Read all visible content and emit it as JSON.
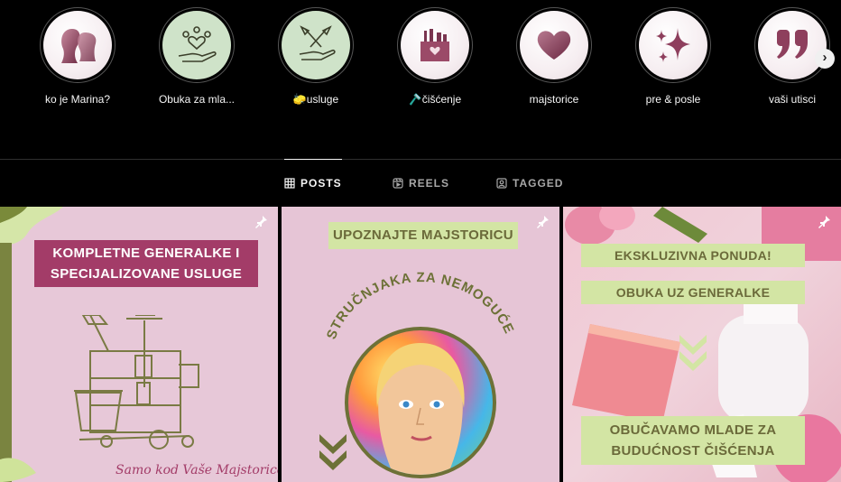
{
  "highlights": [
    {
      "label": "ko je Marina?",
      "icon": "women-faces-icon"
    },
    {
      "label": "Obuka za mla...",
      "icon": "hand-heart-people-icon"
    },
    {
      "label": "🧽usluge",
      "icon": "hand-brooms-icon"
    },
    {
      "label": "🪒čišćenje",
      "icon": "cleaning-bucket-heart-icon"
    },
    {
      "label": "majstorice",
      "icon": "heart-icon"
    },
    {
      "label": "pre & posle",
      "icon": "sparkles-icon"
    },
    {
      "label": "vaši utisci",
      "icon": "quote-icon"
    }
  ],
  "tabs": [
    {
      "label": "POSTS",
      "active": true
    },
    {
      "label": "REELS",
      "active": false
    },
    {
      "label": "TAGGED",
      "active": false
    }
  ],
  "posts": {
    "p1": {
      "banner": "KOMPLETNE GENERALKE I SPECIJALIZOVANE USLUGE",
      "footer": "Samo kod Vaše Majstorice"
    },
    "p2": {
      "banner": "UPOZNAJTE MAJSTORICU",
      "arc": "STRUČNJAKA ZA NEMOGUĆE!"
    },
    "p3": {
      "banner1": "EKSKLUZIVNA PONUDA!",
      "banner2": "OBUKA UZ GENERALKE",
      "banner3": "OBUČAVAMO MLADE ZA BUDUĆNOST ČIŠĆENJA"
    }
  },
  "colors": {
    "accent_pink": "#a33c68",
    "accent_green": "#d3e5a4",
    "olive": "#6d7137"
  }
}
